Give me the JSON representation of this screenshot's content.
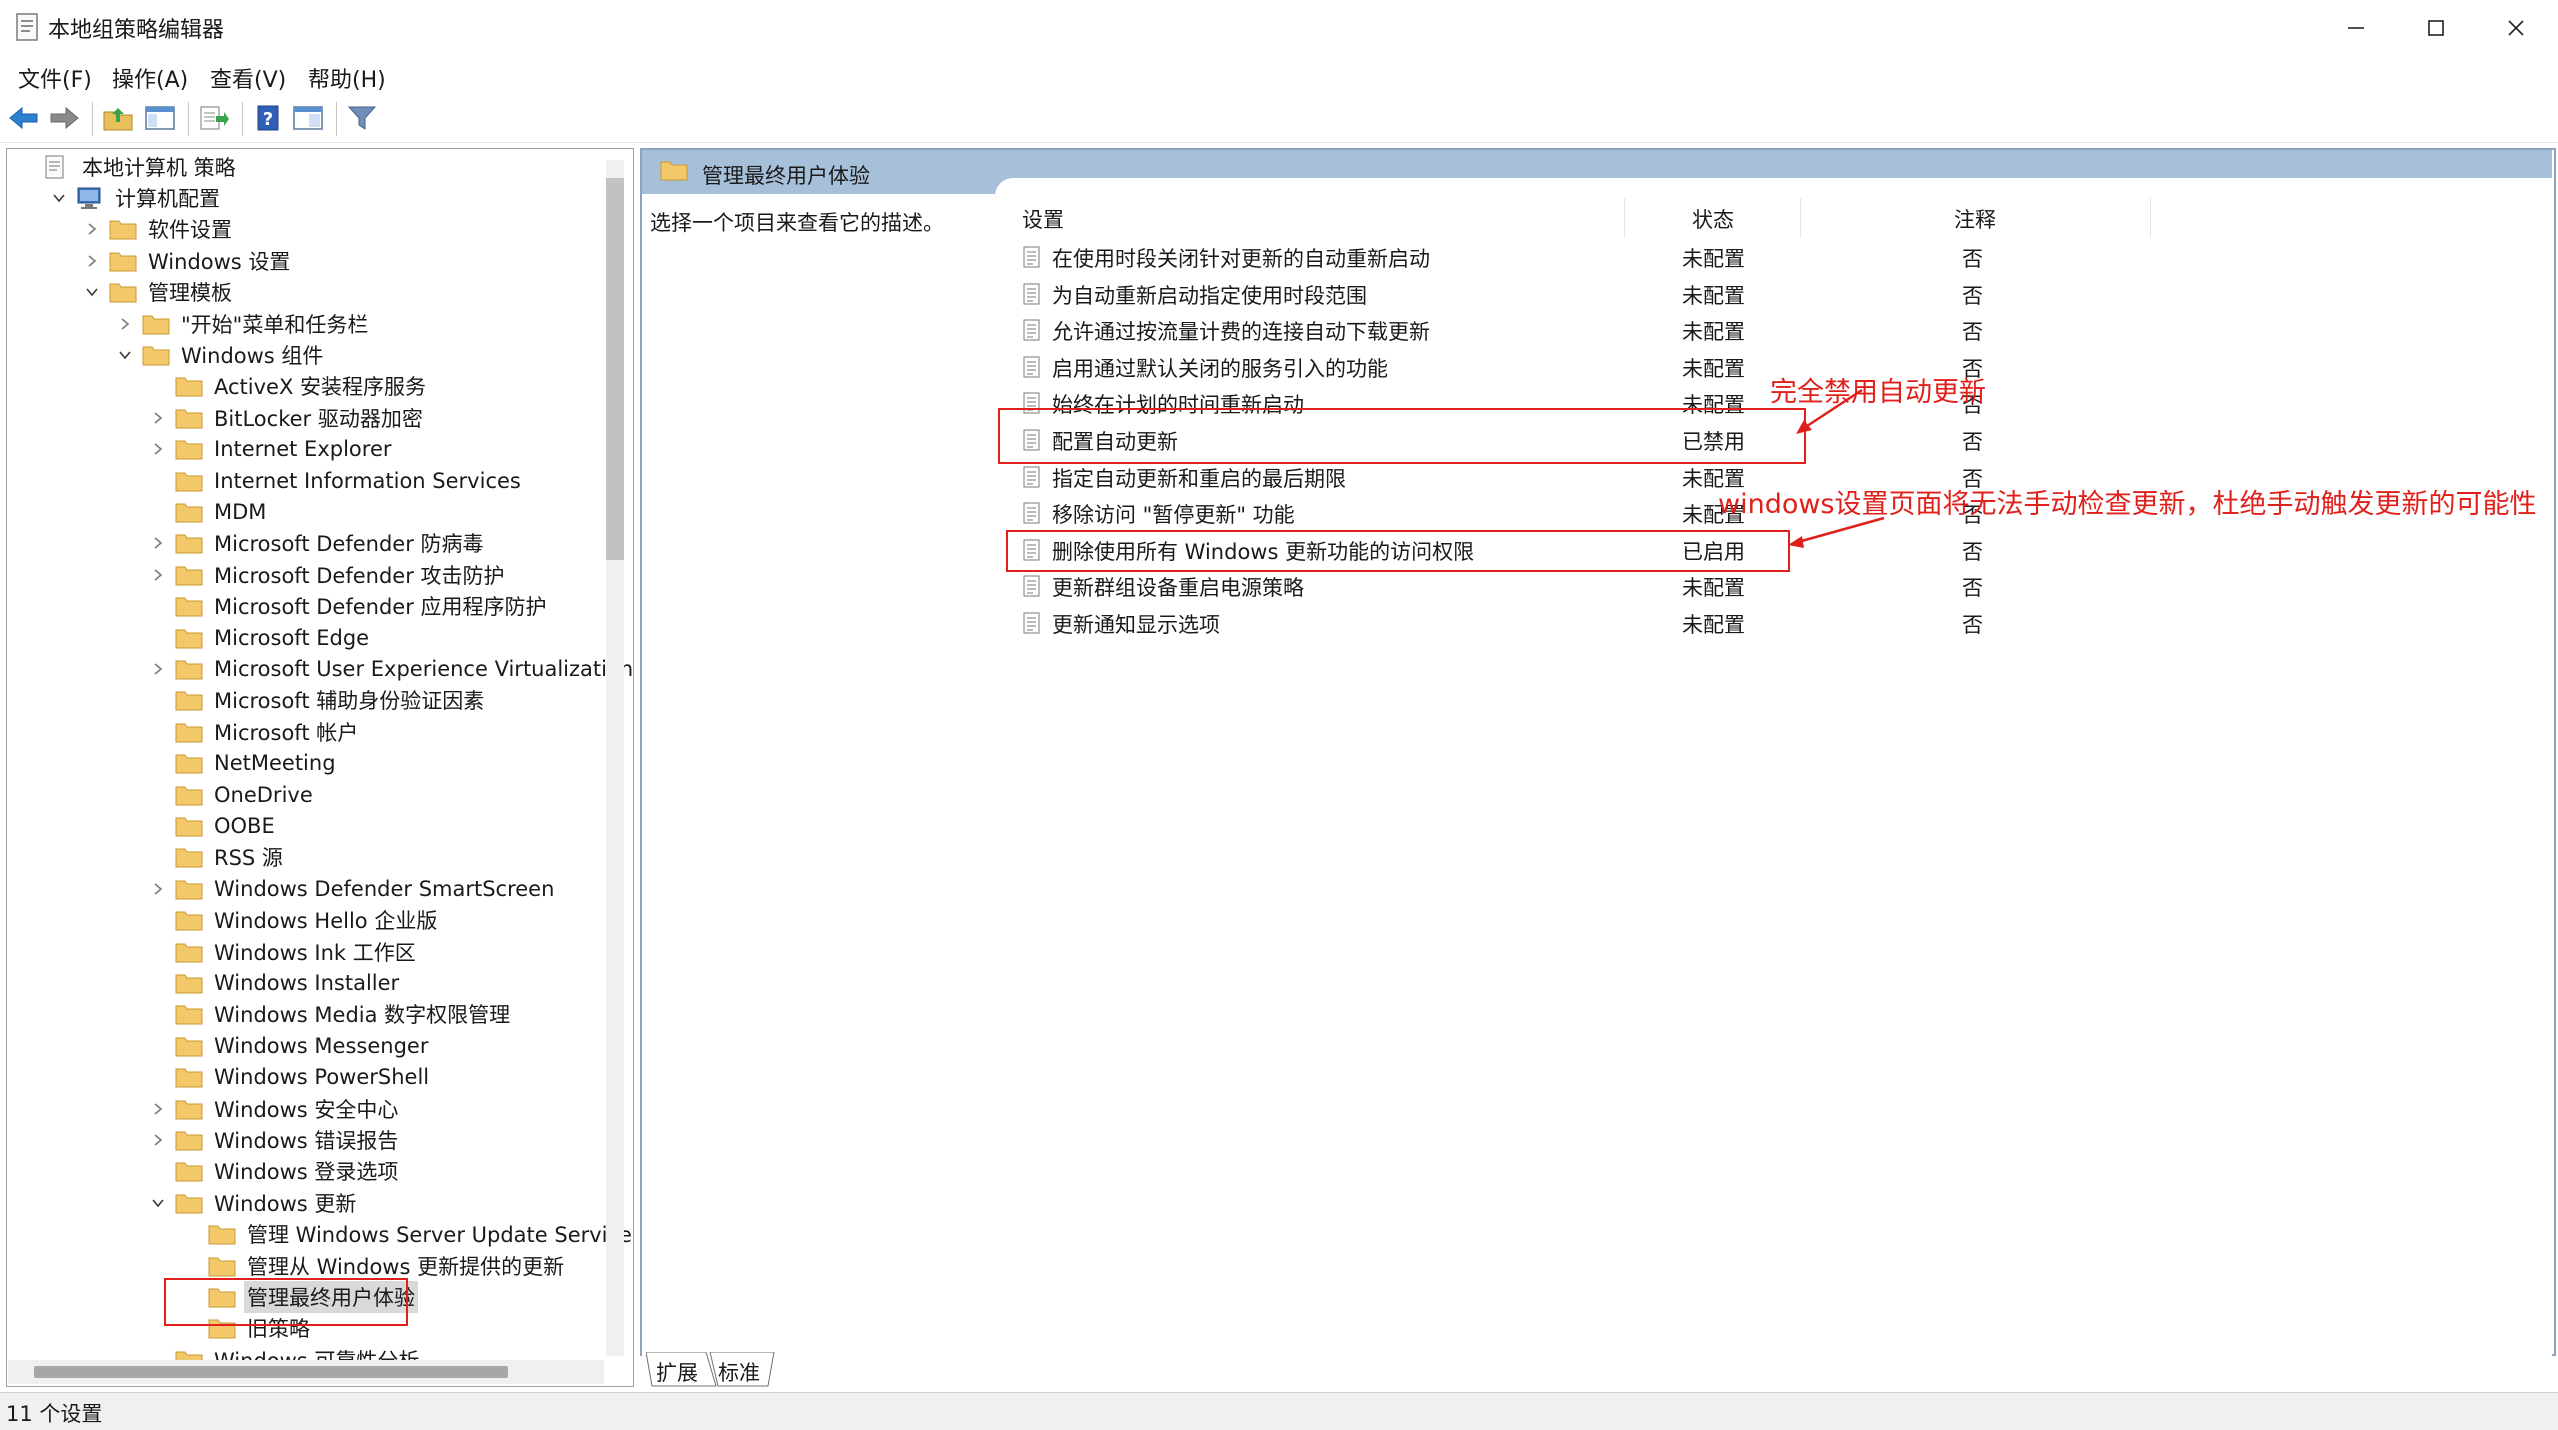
{
  "window": {
    "title": "本地组策略编辑器",
    "minimize_icon": "minimize-icon",
    "maximize_icon": "maximize-icon",
    "close_icon": "close-icon"
  },
  "menu": [
    "文件(F)",
    "操作(A)",
    "查看(V)",
    "帮助(H)"
  ],
  "toolbar": [
    "back-arrow-icon",
    "forward-arrow-icon",
    "up-folder-icon",
    "show-hide-tree-icon",
    "export-list-icon",
    "help-icon",
    "properties-icon",
    "filter-icon"
  ],
  "tree": {
    "items": [
      {
        "label": "本地计算机 策略",
        "level": 0,
        "expander": "",
        "icon": "policy-icon"
      },
      {
        "label": "计算机配置",
        "level": 1,
        "expander": "down",
        "icon": "computer-icon"
      },
      {
        "label": "软件设置",
        "level": 2,
        "expander": "right",
        "icon": "folder"
      },
      {
        "label": "Windows 设置",
        "level": 2,
        "expander": "right",
        "icon": "folder"
      },
      {
        "label": "管理模板",
        "level": 2,
        "expander": "down",
        "icon": "folder"
      },
      {
        "label": "\"开始\"菜单和任务栏",
        "level": 3,
        "expander": "right",
        "icon": "folder"
      },
      {
        "label": "Windows 组件",
        "level": 3,
        "expander": "down",
        "icon": "folder"
      },
      {
        "label": "ActiveX 安装程序服务",
        "level": 4,
        "expander": "",
        "icon": "folder"
      },
      {
        "label": "BitLocker 驱动器加密",
        "level": 4,
        "expander": "right",
        "icon": "folder"
      },
      {
        "label": "Internet Explorer",
        "level": 4,
        "expander": "right",
        "icon": "folder"
      },
      {
        "label": "Internet Information Services",
        "level": 4,
        "expander": "",
        "icon": "folder"
      },
      {
        "label": "MDM",
        "level": 4,
        "expander": "",
        "icon": "folder"
      },
      {
        "label": "Microsoft Defender 防病毒",
        "level": 4,
        "expander": "right",
        "icon": "folder"
      },
      {
        "label": "Microsoft Defender 攻击防护",
        "level": 4,
        "expander": "right",
        "icon": "folder"
      },
      {
        "label": "Microsoft Defender 应用程序防护",
        "level": 4,
        "expander": "",
        "icon": "folder"
      },
      {
        "label": "Microsoft Edge",
        "level": 4,
        "expander": "",
        "icon": "folder"
      },
      {
        "label": "Microsoft User Experience Virtualization",
        "level": 4,
        "expander": "right",
        "icon": "folder"
      },
      {
        "label": "Microsoft 辅助身份验证因素",
        "level": 4,
        "expander": "",
        "icon": "folder"
      },
      {
        "label": "Microsoft 帐户",
        "level": 4,
        "expander": "",
        "icon": "folder"
      },
      {
        "label": "NetMeeting",
        "level": 4,
        "expander": "",
        "icon": "folder"
      },
      {
        "label": "OneDrive",
        "level": 4,
        "expander": "",
        "icon": "folder"
      },
      {
        "label": "OOBE",
        "level": 4,
        "expander": "",
        "icon": "folder"
      },
      {
        "label": "RSS 源",
        "level": 4,
        "expander": "",
        "icon": "folder"
      },
      {
        "label": "Windows Defender SmartScreen",
        "level": 4,
        "expander": "right",
        "icon": "folder"
      },
      {
        "label": "Windows Hello 企业版",
        "level": 4,
        "expander": "",
        "icon": "folder"
      },
      {
        "label": "Windows Ink 工作区",
        "level": 4,
        "expander": "",
        "icon": "folder"
      },
      {
        "label": "Windows Installer",
        "level": 4,
        "expander": "",
        "icon": "folder"
      },
      {
        "label": "Windows Media 数字权限管理",
        "level": 4,
        "expander": "",
        "icon": "folder"
      },
      {
        "label": "Windows Messenger",
        "level": 4,
        "expander": "",
        "icon": "folder"
      },
      {
        "label": "Windows PowerShell",
        "level": 4,
        "expander": "",
        "icon": "folder"
      },
      {
        "label": "Windows 安全中心",
        "level": 4,
        "expander": "right",
        "icon": "folder"
      },
      {
        "label": "Windows 错误报告",
        "level": 4,
        "expander": "right",
        "icon": "folder"
      },
      {
        "label": "Windows 登录选项",
        "level": 4,
        "expander": "",
        "icon": "folder"
      },
      {
        "label": "Windows 更新",
        "level": 4,
        "expander": "down",
        "icon": "folder"
      },
      {
        "label": "管理 Windows Server Update Service 提供",
        "level": 5,
        "expander": "",
        "icon": "folder"
      },
      {
        "label": "管理从 Windows 更新提供的更新",
        "level": 5,
        "expander": "",
        "icon": "folder"
      },
      {
        "label": "管理最终用户体验",
        "level": 5,
        "expander": "",
        "icon": "folder",
        "selected": true
      },
      {
        "label": "旧策略",
        "level": 5,
        "expander": "",
        "icon": "folder"
      },
      {
        "label": "Windows 可靠性分析",
        "level": 4,
        "expander": "",
        "icon": "folder"
      }
    ]
  },
  "right": {
    "header_title": "管理最终用户体验",
    "description": "选择一个项目来查看它的描述。",
    "columns": {
      "setting": "设置",
      "state": "状态",
      "comment": "注释"
    },
    "rows": [
      {
        "name": "在使用时段关闭针对更新的自动重新启动",
        "state": "未配置",
        "comment": "否"
      },
      {
        "name": "为自动重新启动指定使用时段范围",
        "state": "未配置",
        "comment": "否"
      },
      {
        "name": "允许通过按流量计费的连接自动下载更新",
        "state": "未配置",
        "comment": "否"
      },
      {
        "name": "启用通过默认关闭的服务引入的功能",
        "state": "未配置",
        "comment": "否"
      },
      {
        "name": "始终在计划的时间重新启动",
        "state": "未配置",
        "comment": "否"
      },
      {
        "name": "配置自动更新",
        "state": "已禁用",
        "comment": "否"
      },
      {
        "name": "指定自动更新和重启的最后期限",
        "state": "未配置",
        "comment": "否"
      },
      {
        "name": "移除访问 \"暂停更新\" 功能",
        "state": "未配置",
        "comment": "否"
      },
      {
        "name": "删除使用所有 Windows 更新功能的访问权限",
        "state": "已启用",
        "comment": "否"
      },
      {
        "name": "更新群组设备重启电源策略",
        "state": "未配置",
        "comment": "否"
      },
      {
        "name": "更新通知显示选项",
        "state": "未配置",
        "comment": "否"
      }
    ]
  },
  "tabs": [
    "扩展",
    "标准"
  ],
  "status": "11 个设置",
  "annotations": {
    "note1": "完全禁用自动更新",
    "note2": "windows设置页面将无法手动检查更新，杜绝手动触发更新的可能性",
    "color": "#e0201b"
  },
  "colors": {
    "header_bar": "#a7c0da",
    "panel_border": "#8ba3bf",
    "folder": "#f2c86b",
    "selected": "#d9d9d9"
  }
}
